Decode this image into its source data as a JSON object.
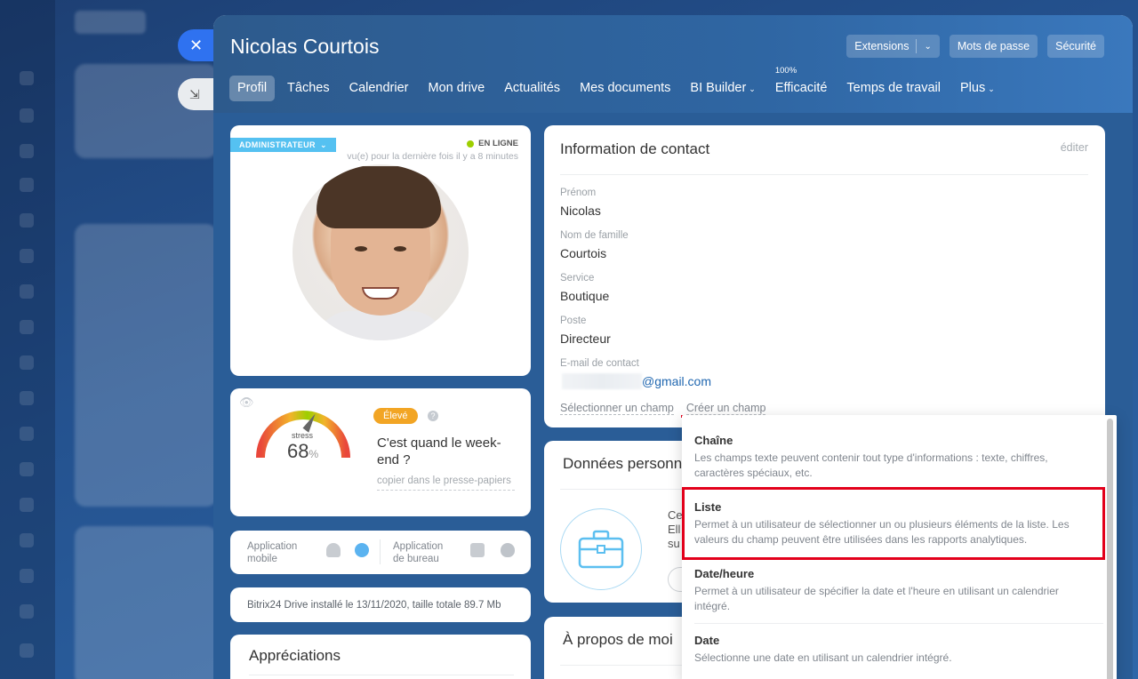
{
  "header": {
    "user_name": "Nicolas Courtois",
    "buttons": {
      "extensions": "Extensions",
      "passwords": "Mots de passe",
      "security": "Sécurité"
    }
  },
  "tabs": [
    {
      "label": "Profil",
      "active": true
    },
    {
      "label": "Tâches"
    },
    {
      "label": "Calendrier"
    },
    {
      "label": "Mon drive"
    },
    {
      "label": "Actualités"
    },
    {
      "label": "Mes documents"
    },
    {
      "label": "BI Builder",
      "dropdown": true
    },
    {
      "label": "Efficacité",
      "superscript": "100%"
    },
    {
      "label": "Temps de travail"
    },
    {
      "label": "Plus",
      "dropdown": true
    }
  ],
  "profile": {
    "role": "ADMINISTRATEUR",
    "status": "EN LIGNE",
    "last_seen": "vu(e) pour la dernière fois il y a 8 minutes"
  },
  "stress": {
    "label": "stress",
    "value": "68",
    "unit": "%",
    "level": "Élevé",
    "message": "C'est quand le week-end ?",
    "copy": "copier dans le presse-papiers",
    "fraction": 0.68
  },
  "apps": {
    "mobile": "Application mobile",
    "desktop": "Application de bureau"
  },
  "drive": {
    "text": "Bitrix24 Drive installé le 13/11/2020, taille totale 89.7 Mb"
  },
  "appreciations": {
    "title": "Appréciations"
  },
  "contact": {
    "title": "Information de contact",
    "edit": "éditer",
    "fields": [
      {
        "label": "Prénom",
        "value": "Nicolas"
      },
      {
        "label": "Nom de famille",
        "value": "Courtois"
      },
      {
        "label": "Service",
        "value": "Boutique"
      },
      {
        "label": "Poste",
        "value": "Directeur"
      },
      {
        "label": "E-mail de contact",
        "value": "@gmail.com"
      }
    ],
    "select_field": "Sélectionner un champ",
    "create_field": "Créer un champ"
  },
  "personal": {
    "title": "Données personne",
    "text_lines": [
      "Ce",
      "Ell",
      "su"
    ]
  },
  "about": {
    "title": "À propos de moi"
  },
  "field_types": [
    {
      "title": "Chaîne",
      "desc": "Les champs texte peuvent contenir tout type d'informations : texte, chiffres, caractères spéciaux, etc."
    },
    {
      "title": "Liste",
      "desc": "Permet à un utilisateur de sélectionner un ou plusieurs éléments de la liste. Les valeurs du champ peuvent être utilisées dans les rapports analytiques.",
      "highlighted": true
    },
    {
      "title": "Date/heure",
      "desc": "Permet à un utilisateur de spécifier la date et l'heure en utilisant un calendrier intégré."
    },
    {
      "title": "Date",
      "desc": "Sélectionne une date en utilisant un calendrier intégré."
    }
  ],
  "colors": {
    "accent": "#2f72f0",
    "badge": "#55c1f1",
    "online": "#9dcf00",
    "level": "#f2a524",
    "highlight": "#e3001b"
  }
}
